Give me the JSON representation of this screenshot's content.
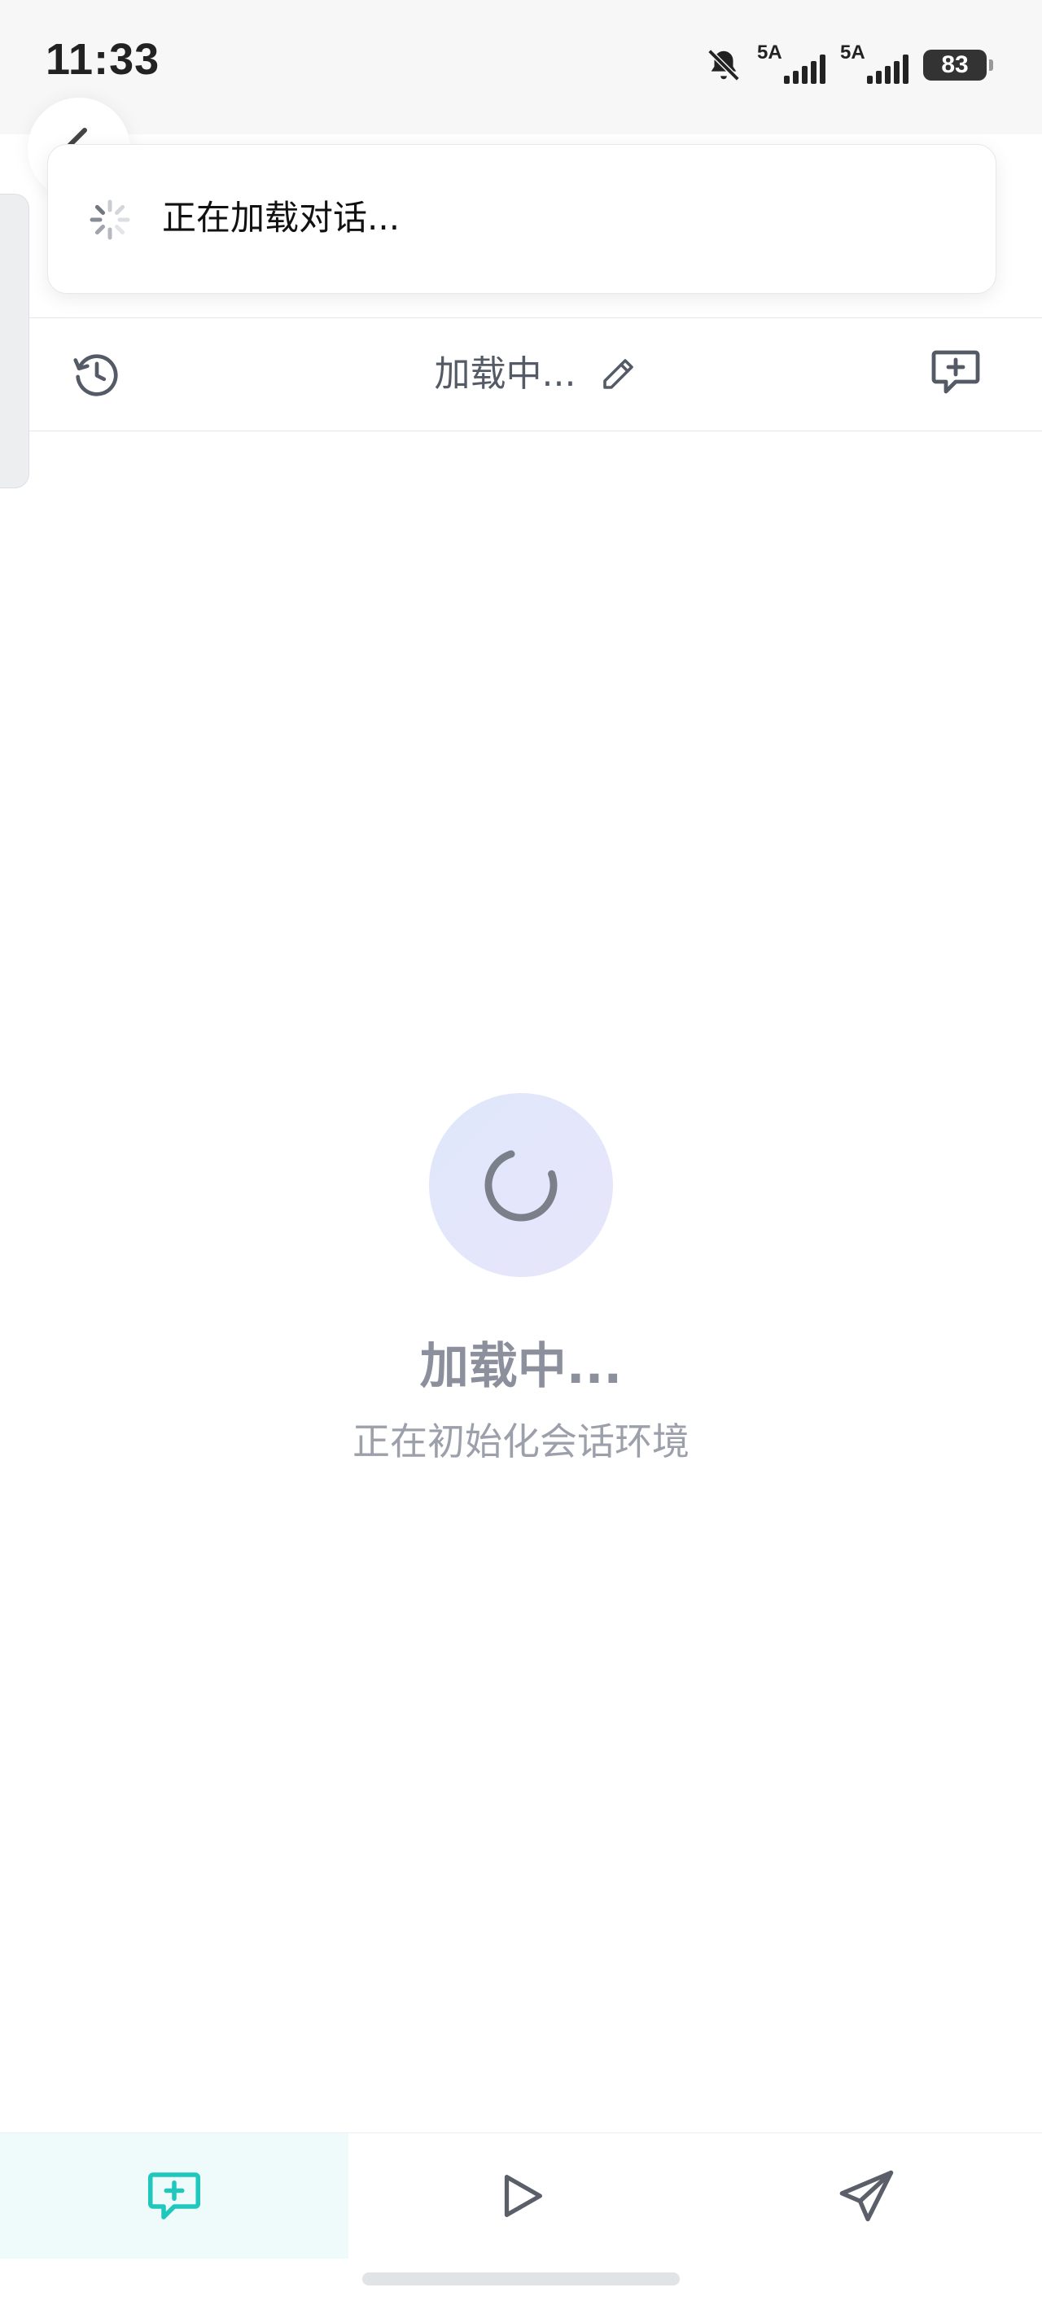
{
  "status_bar": {
    "time": "11:33",
    "signal_1_label": "5A",
    "signal_2_label": "5A",
    "battery_level": "83",
    "icons": [
      "bell-off-icon",
      "signal-icon",
      "signal-icon",
      "battery-icon"
    ]
  },
  "toast": {
    "message": "正在加载对话...",
    "icon": "spinner-icon"
  },
  "header": {
    "title": "加载中...",
    "history_icon": "history-icon",
    "edit_icon": "pencil-icon",
    "new_chat_icon": "new-chat-icon"
  },
  "main": {
    "loading_title": "加载中...",
    "loading_subtitle": "正在初始化会话环境",
    "icon": "loading-spinner-icon"
  },
  "bottom_nav": {
    "items": [
      {
        "icon": "chat-plus-icon",
        "active": true
      },
      {
        "icon": "play-icon",
        "active": false
      },
      {
        "icon": "send-icon",
        "active": false
      }
    ]
  },
  "colors": {
    "accent": "#1fc7bd",
    "muted_text": "#8b909c",
    "loader_bg": "#e3e7fb"
  }
}
